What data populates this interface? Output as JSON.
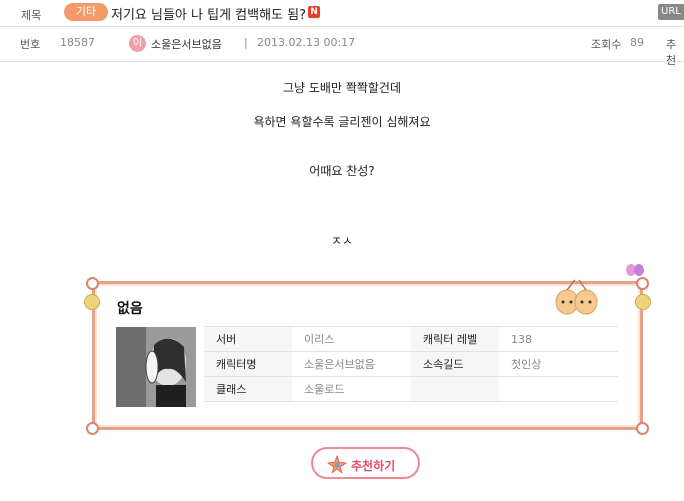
{
  "title_row": {
    "label": "제목",
    "category": "기타",
    "title": "저기요 님들아 나 팁게 컴백해도 됨?",
    "new_badge": "N",
    "url_button": "URL"
  },
  "meta_row": {
    "number_label": "번호",
    "number": "18587",
    "avatar_letter": "이",
    "author": "소울은서브없음",
    "separator": "|",
    "datetime": "2013.02.13 00:17",
    "views_label": "조회수",
    "views": "89",
    "recommend_label": "추천"
  },
  "content": {
    "lines": [
      "그냥 도배만 쫙쫙할건데",
      "욕하면 욕할수록 글리젠이 심해져요",
      "어때요 찬성?",
      "ㅈㅅ"
    ]
  },
  "profile": {
    "name": "없음",
    "rows": [
      {
        "k1": "서버",
        "v1": "이리스",
        "k2": "캐릭터 레벨",
        "v2": "138"
      },
      {
        "k1": "캐릭터명",
        "v1": "소울은서브없음",
        "k2": "소속길드",
        "v2": "첫인상"
      },
      {
        "k1": "클래스",
        "v1": "소울로드",
        "k2": "",
        "v2": ""
      }
    ]
  },
  "recommend_button": {
    "label": "추천하기"
  },
  "colors": {
    "accent": "#e6496a",
    "badge": "#f39a6b",
    "frame": "#e8a089"
  }
}
